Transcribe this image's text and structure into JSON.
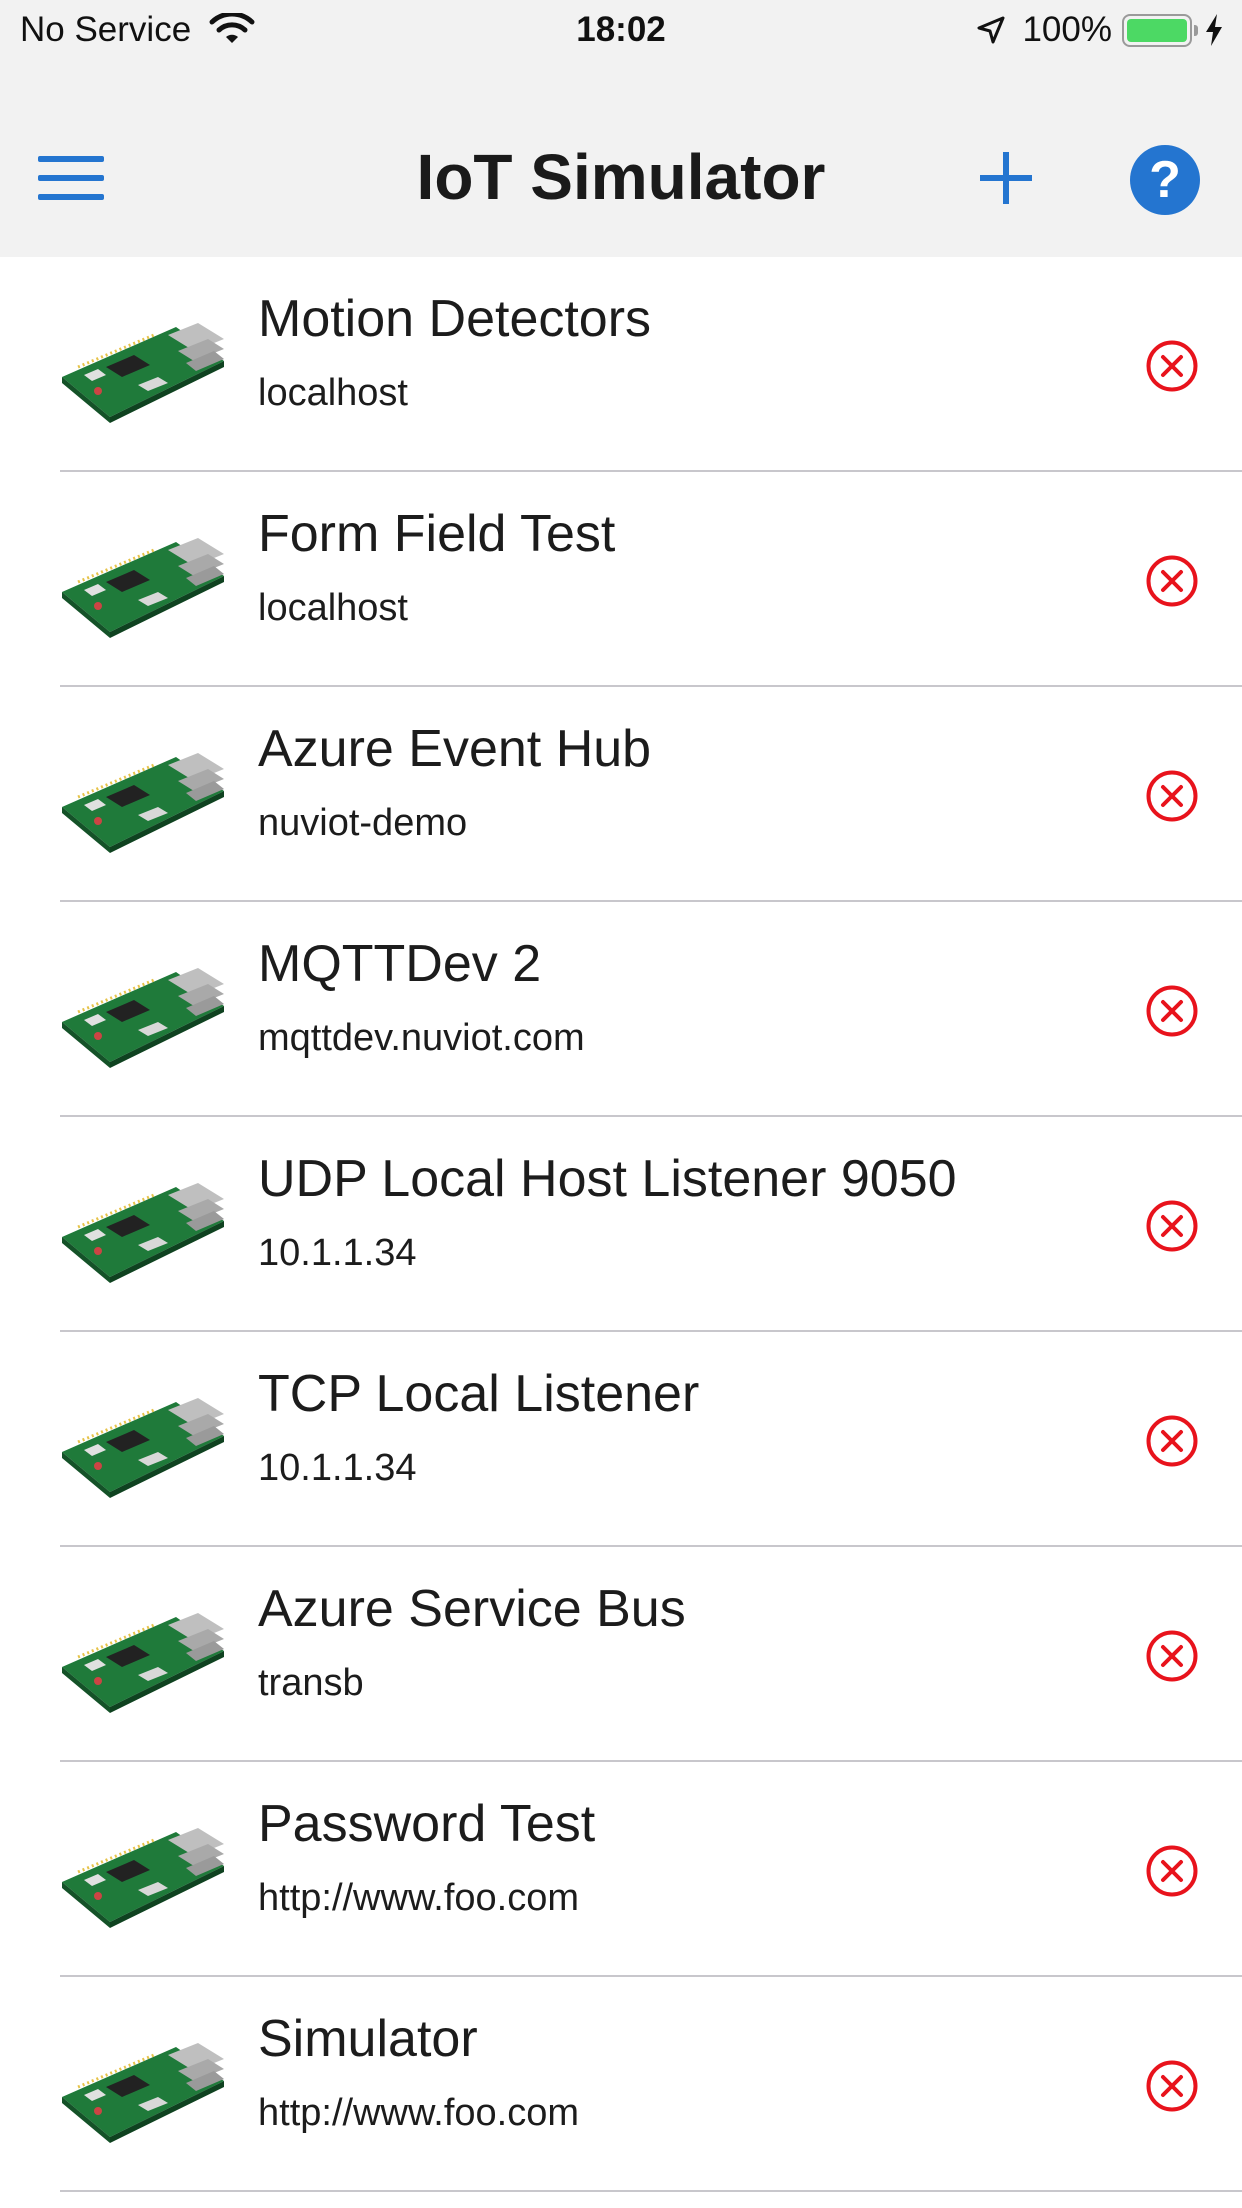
{
  "status_bar": {
    "carrier": "No Service",
    "time": "18:02",
    "battery": "100%"
  },
  "nav": {
    "title": "IoT Simulator",
    "help_glyph": "?"
  },
  "colors": {
    "accent": "#2475d0",
    "remove": "#e8131c",
    "battery": "#4cd964"
  },
  "icons": {
    "menu": "menu-icon",
    "add": "plus-icon",
    "help": "help-icon",
    "thumb": "raspberry-pi-board-image",
    "remove": "remove-circle-x-icon"
  },
  "simulators": [
    {
      "title": "Motion Detectors",
      "host": "localhost"
    },
    {
      "title": "Form Field Test",
      "host": "localhost"
    },
    {
      "title": "Azure Event Hub",
      "host": "nuviot-demo"
    },
    {
      "title": "MQTTDev 2",
      "host": "mqttdev.nuviot.com"
    },
    {
      "title": "UDP Local Host Listener 9050",
      "host": "10.1.1.34"
    },
    {
      "title": "TCP Local Listener",
      "host": "10.1.1.34"
    },
    {
      "title": "Azure Service Bus",
      "host": "transb"
    },
    {
      "title": "Password Test",
      "host": "http://www.foo.com"
    },
    {
      "title": "Simulator",
      "host": "http://www.foo.com"
    }
  ]
}
